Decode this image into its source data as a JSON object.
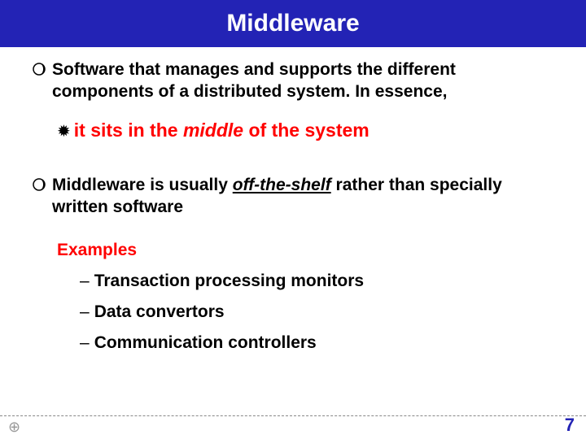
{
  "title": "Middleware",
  "bullet1": "Software that manages and supports the different components of a distributed system. In essence,",
  "sub_red_prefix": "it sits in the ",
  "sub_red_italic": "middle",
  "sub_red_suffix": " of the system",
  "bullet2_prefix": "Middleware is usually ",
  "bullet2_underline": "off-the-shelf",
  "bullet2_suffix": " rather than specially written software",
  "examples_label": "Examples",
  "examples": [
    "Transaction processing monitors",
    "Data convertors",
    "Communication controllers"
  ],
  "slide_number": "7"
}
